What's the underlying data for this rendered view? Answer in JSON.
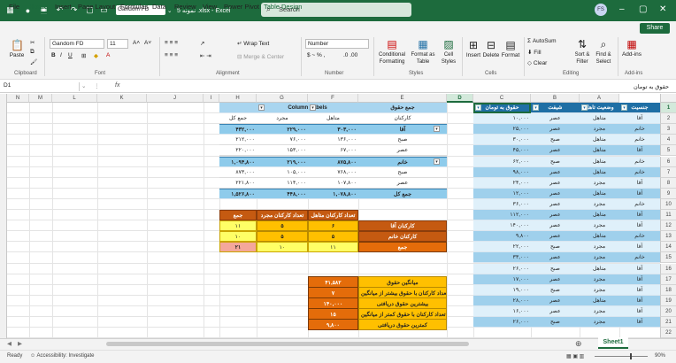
{
  "titlebar": {
    "font_box": "Gandom FD",
    "doc": "5 نمونه .xlsx  -  Excel",
    "search_placeholder": "Search",
    "avatar": "FS"
  },
  "menu": {
    "items": [
      "File",
      "Home",
      "Insert",
      "Page Layout",
      "Formulas",
      "Data",
      "Review",
      "View",
      "Power Pivot",
      "Table Design"
    ],
    "share": "Share"
  },
  "ribbon": {
    "clipboard": {
      "paste": "Paste",
      "group": "Clipboard"
    },
    "font": {
      "name": "Gandom FD",
      "size": "11",
      "group": "Font"
    },
    "alignment": {
      "wrap": "Wrap Text",
      "merge": "Merge & Center",
      "group": "Alignment"
    },
    "number": {
      "format": "Number",
      "group": "Number"
    },
    "styles": {
      "cond": "Conditional Formatting",
      "fmt_table": "Format as Table",
      "cell_styles": "Cell Styles",
      "group": "Styles"
    },
    "cells": {
      "insert": "Insert",
      "delete": "Delete",
      "format": "Format",
      "group": "Cells"
    },
    "editing": {
      "autosum": "AutoSum",
      "fill": "Fill",
      "clear": "Clear",
      "sort": "Sort & Filter",
      "find": "Find & Select",
      "group": "Editing"
    },
    "addins": {
      "label": "Add-ins",
      "group": "Add-ins"
    }
  },
  "formula_bar": {
    "name_box": "D1",
    "fx": "fx",
    "value": "حقوق به تومان"
  },
  "columns": [
    "N",
    "M",
    "L",
    "K",
    "J",
    "I",
    "H",
    "G",
    "F",
    "E",
    "D",
    "C",
    "B",
    "A"
  ],
  "rows": [
    "1",
    "2",
    "3",
    "4",
    "5",
    "6",
    "7",
    "8",
    "9",
    "10",
    "11",
    "12",
    "13",
    "14",
    "15",
    "16",
    "17",
    "18",
    "19",
    "20",
    "21",
    "22",
    "23"
  ],
  "main_table": {
    "headers": [
      "حقوق به تومان",
      "شیفت",
      "وضعیت تاهل",
      "جنسیت"
    ],
    "rows": [
      [
        "۱۰,۰۰۰",
        "عصر",
        "متاهل",
        "آقا"
      ],
      [
        "۲۵,۰۰۰",
        "عصر",
        "مجرد",
        "خانم"
      ],
      [
        "۳۰,۰۰۰",
        "صبح",
        "متاهل",
        "خانم"
      ],
      [
        "۴۵,۰۰۰",
        "عصر",
        "متاهل",
        "آقا"
      ],
      [
        "۶۲,۰۰۰",
        "صبح",
        "متاهل",
        "خانم"
      ],
      [
        "۹۸,۰۰۰",
        "عصر",
        "متاهل",
        "خانم"
      ],
      [
        "۲۴,۰۰۰",
        "عصر",
        "مجرد",
        "آقا"
      ],
      [
        "۱۲,۰۰۰",
        "عصر",
        "متاهل",
        "آقا"
      ],
      [
        "۳۶,۰۰۰",
        "عصر",
        "مجرد",
        "خانم"
      ],
      [
        "۱۱۲,۰۰۰",
        "عصر",
        "متاهل",
        "آقا"
      ],
      [
        "۱۴۰,۰۰۰",
        "عصر",
        "مجرد",
        "آقا"
      ],
      [
        "۹,۸۰۰",
        "عصر",
        "متاهل",
        "خانم"
      ],
      [
        "۲۲,۰۰۰",
        "صبح",
        "مجرد",
        "آقا"
      ],
      [
        "۳۳,۰۰۰",
        "عصر",
        "مجرد",
        "خانم"
      ],
      [
        "۲۶,۰۰۰",
        "صبح",
        "متاهل",
        "آقا"
      ],
      [
        "۱۷,۰۰۰",
        "عصر",
        "مجرد",
        "آقا"
      ],
      [
        "۱۹,۰۰۰",
        "صبح",
        "مجرد",
        "آقا"
      ],
      [
        "۲۸,۰۰۰",
        "عصر",
        "متاهل",
        "آقا"
      ],
      [
        "۱۶,۰۰۰",
        "عصر",
        "مجرد",
        "آقا"
      ],
      [
        "۲۶,۰۰۰",
        "صبح",
        "مجرد",
        "آقا"
      ]
    ]
  },
  "pivot": {
    "corner": "جمع حقوق",
    "col_labels": "Column Labels",
    "row_hdr": "کارکنان",
    "col_married": "متاهل",
    "col_single": "مجرد",
    "col_total": "جمع کل",
    "rows": [
      {
        "label": "آقا",
        "m": "۳۰۳,۰۰۰",
        "s": "۲۲۹,۰۰۰",
        "t": "۴۳۲,۰۰۰"
      },
      {
        "label": "صبح",
        "m": "۱۳۶,۰۰۰",
        "s": "۷۶,۰۰۰",
        "t": "۲۱۲,۰۰۰"
      },
      {
        "label": "عصر",
        "m": "۶۷,۰۰۰",
        "s": "۱۵۳,۰۰۰",
        "t": "۲۲۰,۰۰۰"
      },
      {
        "label": "خانم",
        "m": "۸۷۵,۸۰۰",
        "s": "۲۱۹,۰۰۰",
        "t": "۱,۰۹۴,۸۰۰"
      },
      {
        "label": "صبح",
        "m": "۷۶۸,۰۰۰",
        "s": "۱۰۵,۰۰۰",
        "t": "۸۷۳,۰۰۰"
      },
      {
        "label": "عصر",
        "m": "۱۰۷,۸۰۰",
        "s": "۱۱۴,۰۰۰",
        "t": "۲۲۱,۸۰۰"
      }
    ],
    "grand": {
      "label": "جمع کل",
      "m": "۱,۰۷۸,۸۰۰",
      "s": "۴۴۸,۰۰۰",
      "t": "۱,۵۲۶,۸۰۰"
    }
  },
  "counts": {
    "headers": [
      "تعداد کارکنان متاهل",
      "تعداد کارکنان مجرد",
      "جمع"
    ],
    "rows": [
      {
        "label": "کارکنان آقا",
        "m": "۶",
        "s": "۵",
        "t": "۱۱"
      },
      {
        "label": "کارکنان خانم",
        "m": "۵",
        "s": "۵",
        "t": "۱۰"
      },
      {
        "label": "جمع",
        "m": "۱۱",
        "s": "۱۰",
        "t": "۲۱"
      }
    ]
  },
  "stats": [
    {
      "label": "میانگین حقوق",
      "value": "۴۱,۵۸۲"
    },
    {
      "label": "تعداد کارکنان با حقوق بیشتر از میانگین",
      "value": "۷"
    },
    {
      "label": "بیشترین حقوق دریافتی",
      "value": "۱۴۰,۰۰۰"
    },
    {
      "label": "تعداد کارکنان با حقوق کمتر از میانگین",
      "value": "۱۵"
    },
    {
      "label": "کمترین حقوق دریافتی",
      "value": "۹,۸۰۰"
    }
  ],
  "sheet": {
    "tab": "Sheet1",
    "ready": "Ready",
    "accessibility": "Accessibility: Investigate",
    "zoom": "90%"
  }
}
